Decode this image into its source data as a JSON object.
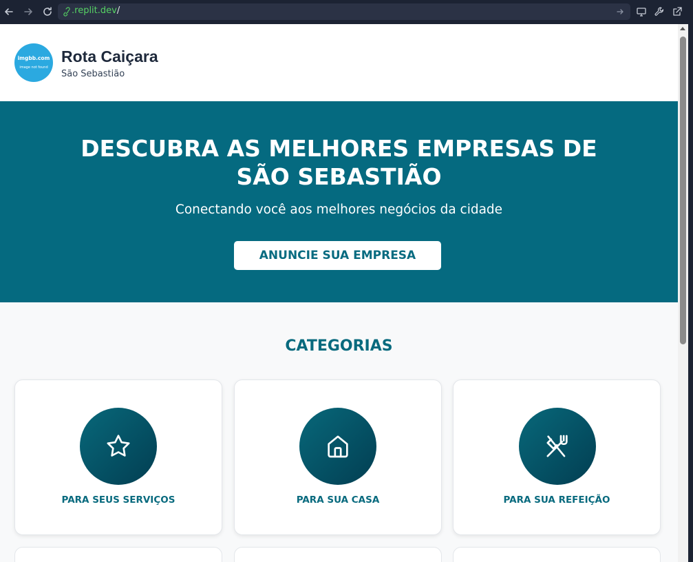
{
  "browser": {
    "url_domain": ".replit.dev",
    "url_path": "/"
  },
  "header": {
    "logo_line1": "imgbb.com",
    "logo_line2": "image not found",
    "brand_name": "Rota Caiçara",
    "city": "São Sebastião"
  },
  "hero": {
    "title": "DESCUBRA AS MELHORES EMPRESAS DE SÃO SEBASTIÃO",
    "subtitle": "Conectando você aos melhores negócios da cidade",
    "cta_label": "ANUNCIE SUA EMPRESA",
    "background_color": "#056a80"
  },
  "categories": {
    "heading": "CATEGORIAS",
    "items": [
      {
        "label": "PARA SEUS SERVIÇOS",
        "icon": "star-icon"
      },
      {
        "label": "PARA SUA CASA",
        "icon": "home-icon"
      },
      {
        "label": "PARA SUA REFEIÇÃO",
        "icon": "utensils-crossed-icon"
      }
    ]
  }
}
